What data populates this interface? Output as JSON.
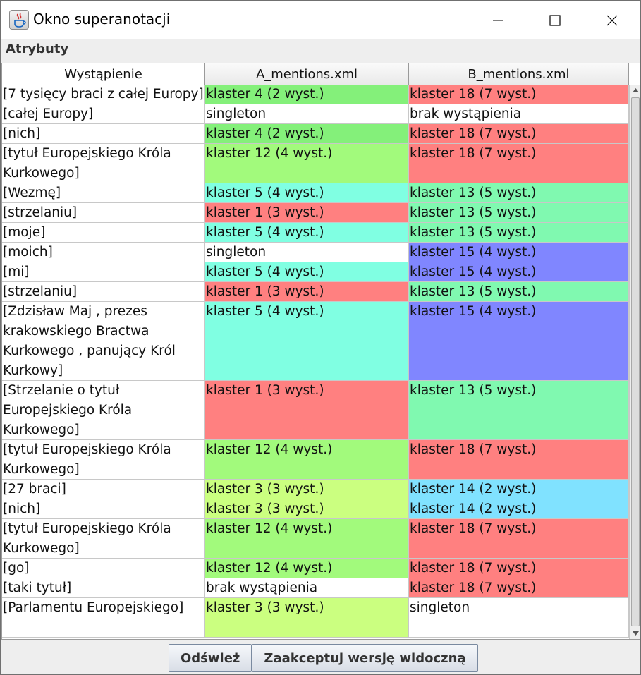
{
  "window": {
    "title": "Okno superanotacji"
  },
  "section": {
    "label": "Atrybuty"
  },
  "colors": {
    "green": "#84f07a",
    "red": "#ff8080",
    "cyan": "#80ffe2",
    "lime": "#a2fa7c",
    "mint": "#80f9b0",
    "blue": "#8086ff",
    "yellowgreen": "#cbff80",
    "lightblue": "#80e2ff",
    "white": "#ffffff"
  },
  "table": {
    "columns": [
      "Wystąpienie",
      "A_mentions.xml",
      "B_mentions.xml"
    ],
    "rows": [
      {
        "mention": "[7 tysięcy braci z całej Europy]",
        "a": "klaster 4 (2 wyst.)",
        "a_color": "green",
        "b": "klaster 18 (7 wyst.)",
        "b_color": "red",
        "lines": 1
      },
      {
        "mention": "[całej Europy]",
        "a": "singleton",
        "a_color": "white",
        "b": "brak wystąpienia",
        "b_color": "white",
        "lines": 1
      },
      {
        "mention": "[nich]",
        "a": "klaster 4 (2 wyst.)",
        "a_color": "green",
        "b": "klaster 18 (7 wyst.)",
        "b_color": "red",
        "lines": 1
      },
      {
        "mention": "[tytuł Europejskiego Króla Kurkowego]",
        "a": "klaster 12 (4 wyst.)",
        "a_color": "lime",
        "b": "klaster 18 (7 wyst.)",
        "b_color": "red",
        "lines": 2
      },
      {
        "mention": "[Wezmę]",
        "a": "klaster 5 (4 wyst.)",
        "a_color": "cyan",
        "b": "klaster 13 (5 wyst.)",
        "b_color": "mint",
        "lines": 1
      },
      {
        "mention": "[strzelaniu]",
        "a": "klaster 1 (3 wyst.)",
        "a_color": "red",
        "b": "klaster 13 (5 wyst.)",
        "b_color": "mint",
        "lines": 1
      },
      {
        "mention": "[moje]",
        "a": "klaster 5 (4 wyst.)",
        "a_color": "cyan",
        "b": "klaster 13 (5 wyst.)",
        "b_color": "mint",
        "lines": 1
      },
      {
        "mention": "[moich]",
        "a": "singleton",
        "a_color": "white",
        "b": "klaster 15 (4 wyst.)",
        "b_color": "blue",
        "lines": 1
      },
      {
        "mention": "[mi]",
        "a": "klaster 5 (4 wyst.)",
        "a_color": "cyan",
        "b": "klaster 15 (4 wyst.)",
        "b_color": "blue",
        "lines": 1
      },
      {
        "mention": "[strzelaniu]",
        "a": "klaster 1 (3 wyst.)",
        "a_color": "red",
        "b": "klaster 13 (5 wyst.)",
        "b_color": "mint",
        "lines": 1
      },
      {
        "mention": "[Zdzisław Maj , prezes krakowskiego Bractwa Kurkowego , panujący Król Kurkowy]",
        "a": "klaster 5 (4 wyst.)",
        "a_color": "cyan",
        "b": "klaster 15 (4 wyst.)",
        "b_color": "blue",
        "lines": 4
      },
      {
        "mention": "[Strzelanie o tytuł Europejskiego Króla Kurkowego]",
        "a": "klaster 1 (3 wyst.)",
        "a_color": "red",
        "b": "klaster 13 (5 wyst.)",
        "b_color": "mint",
        "lines": 3
      },
      {
        "mention": "[tytuł Europejskiego Króla Kurkowego]",
        "a": "klaster 12 (4 wyst.)",
        "a_color": "lime",
        "b": "klaster 18 (7 wyst.)",
        "b_color": "red",
        "lines": 2
      },
      {
        "mention": "[27 braci]",
        "a": "klaster 3 (3 wyst.)",
        "a_color": "yellowgreen",
        "b": "klaster 14 (2 wyst.)",
        "b_color": "lightblue",
        "lines": 1
      },
      {
        "mention": "[nich]",
        "a": "klaster 3 (3 wyst.)",
        "a_color": "yellowgreen",
        "b": "klaster 14 (2 wyst.)",
        "b_color": "lightblue",
        "lines": 1
      },
      {
        "mention": "[tytuł Europejskiego Króla Kurkowego]",
        "a": "klaster 12 (4 wyst.)",
        "a_color": "lime",
        "b": "klaster 18 (7 wyst.)",
        "b_color": "red",
        "lines": 2
      },
      {
        "mention": "[go]",
        "a": "klaster 12 (4 wyst.)",
        "a_color": "lime",
        "b": "klaster 18 (7 wyst.)",
        "b_color": "red",
        "lines": 1
      },
      {
        "mention": "[taki tytuł]",
        "a": "brak wystąpienia",
        "a_color": "white",
        "b": "klaster 18 (7 wyst.)",
        "b_color": "red",
        "lines": 1
      },
      {
        "mention": "[Parlamentu Europejskiego]",
        "a": "klaster 3 (3 wyst.)",
        "a_color": "yellowgreen",
        "b": "singleton",
        "b_color": "white",
        "lines": 2
      }
    ]
  },
  "buttons": {
    "refresh_label": "Odśwież",
    "accept_label": "Zaakceptuj wersję widoczną"
  }
}
